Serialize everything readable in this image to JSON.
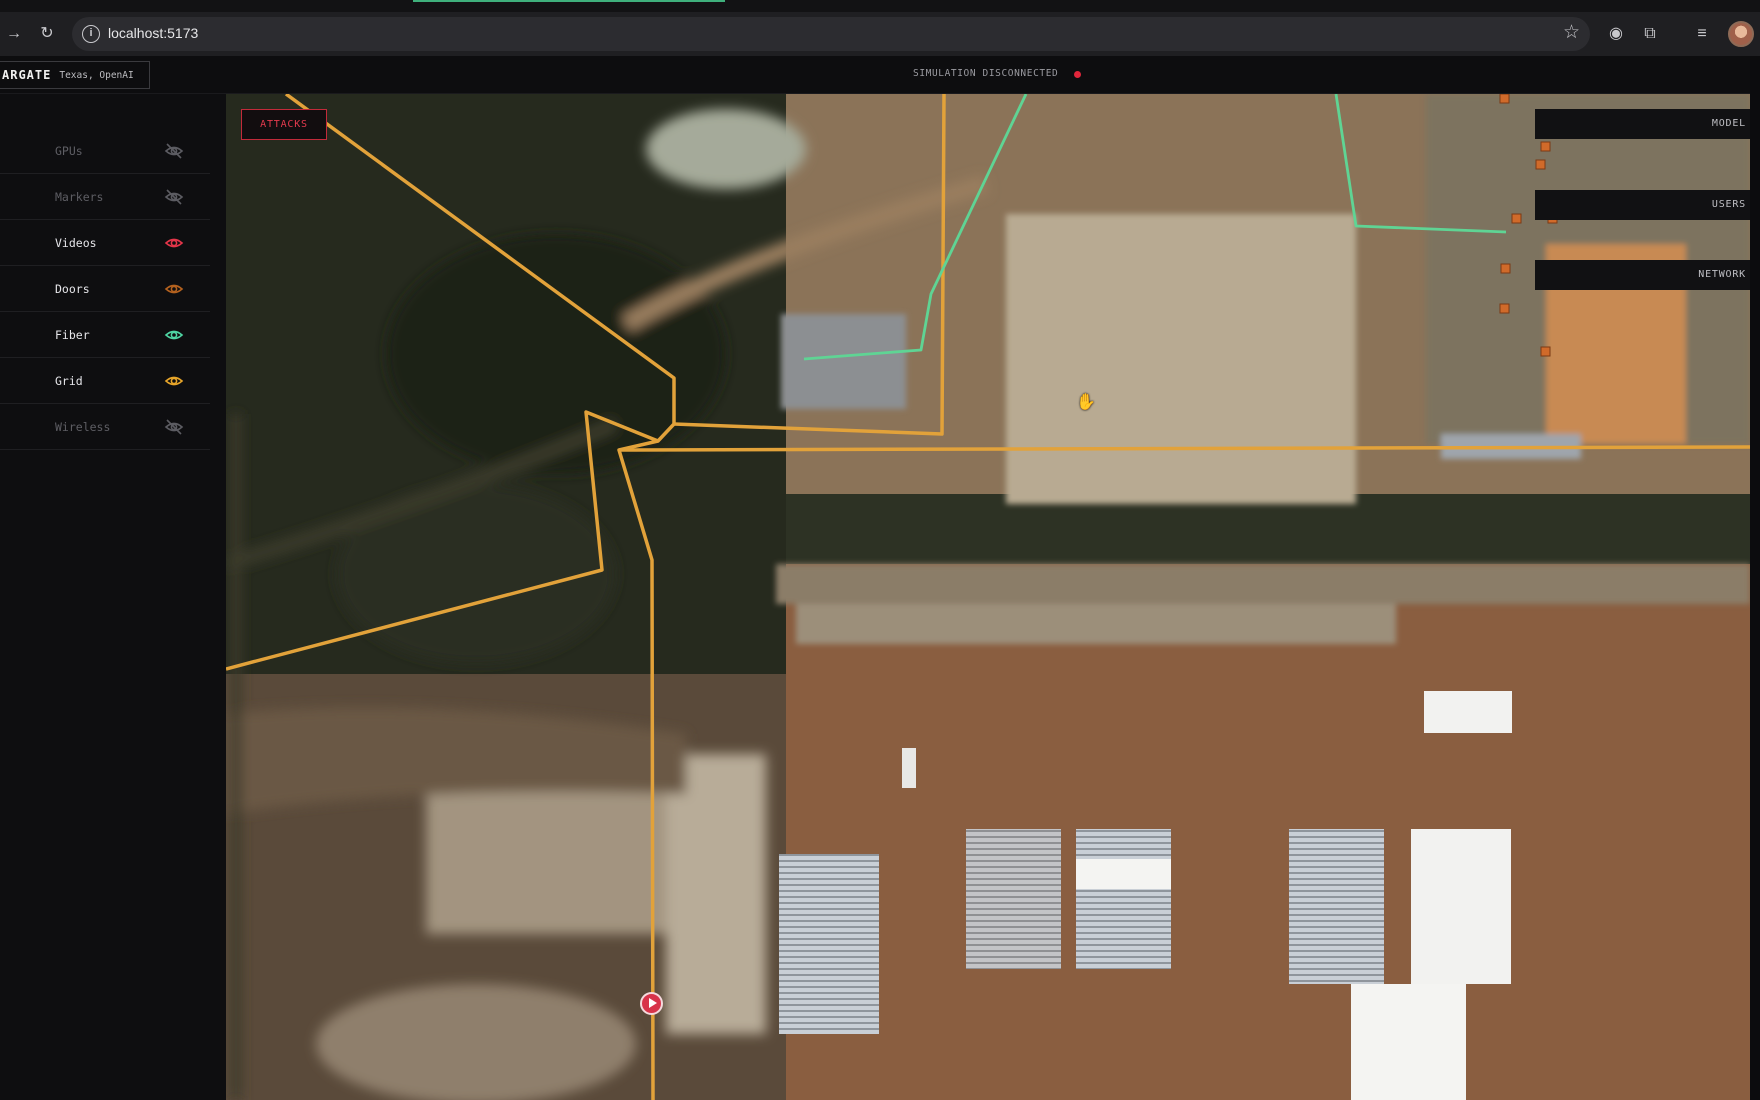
{
  "browser": {
    "url": "localhost:5173",
    "icons": [
      "forward-icon",
      "reload-icon",
      "site-info-icon",
      "bookmark-star-icon",
      "extension-icon",
      "puzzle-icon",
      "media-queue-icon",
      "profile-avatar"
    ]
  },
  "app": {
    "brand_name": "ARGATE",
    "brand_location": "Texas, OpenAI",
    "status_text": "SIMULATION DISCONNECTED",
    "status_color": "#e0263b"
  },
  "layers": [
    {
      "label": "GPUs",
      "visible": false,
      "color": "#5c5c62"
    },
    {
      "label": "Markers",
      "visible": false,
      "color": "#5c5c62"
    },
    {
      "label": "Videos",
      "visible": true,
      "color": "#e5364a"
    },
    {
      "label": "Doors",
      "visible": true,
      "color": "#b5621f"
    },
    {
      "label": "Fiber",
      "visible": true,
      "color": "#4fd6a4"
    },
    {
      "label": "Grid",
      "visible": true,
      "color": "#e8a62a"
    },
    {
      "label": "Wireless",
      "visible": false,
      "color": "#5c5c62"
    }
  ],
  "sidebar": {
    "collapse_glyph": "◂"
  },
  "map": {
    "attacks_label": "ATTACKS",
    "panels": [
      "MODEL",
      "USERS",
      "NETWORK"
    ],
    "grid_line_color": "#e2a23a",
    "fiber_line_color": "#5fd494"
  }
}
